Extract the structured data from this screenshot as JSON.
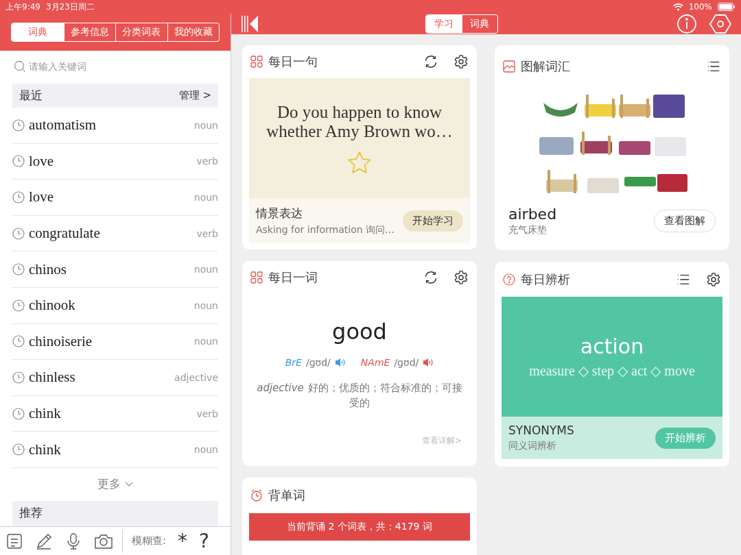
{
  "status_bar": {
    "time": "上午9:49",
    "date": "3月23日周二",
    "battery": "100%"
  },
  "sidebar": {
    "tabs": [
      {
        "label": "词典",
        "selected": true
      },
      {
        "label": "参考信息",
        "selected": false
      },
      {
        "label": "分类词表",
        "selected": false
      },
      {
        "label": "我的收藏",
        "selected": false
      }
    ],
    "search": {
      "placeholder": "请输入关键词"
    },
    "recent": {
      "title": "最近",
      "action": "管理 >"
    },
    "history": [
      {
        "word": "automatism",
        "pos": "noun"
      },
      {
        "word": "love",
        "pos": "verb"
      },
      {
        "word": "love",
        "pos": "noun"
      },
      {
        "word": "congratulate",
        "pos": "verb"
      },
      {
        "word": "chinos",
        "pos": "noun"
      },
      {
        "word": "chinook",
        "pos": "noun"
      },
      {
        "word": "chinoiserie",
        "pos": "noun"
      },
      {
        "word": "chinless",
        "pos": "adjective"
      },
      {
        "word": "chink",
        "pos": "verb"
      },
      {
        "word": "chink",
        "pos": "noun"
      }
    ],
    "more": "更多",
    "recommend": {
      "title": "推荐"
    },
    "toolbar": {
      "fuzzy_label": "模糊查:",
      "keys": [
        "*",
        "?"
      ]
    }
  },
  "mode_tabs": [
    {
      "label": "学习",
      "selected": true
    },
    {
      "label": "词典",
      "selected": false
    }
  ],
  "daily_sentence": {
    "title": "每日一句",
    "sentence_lines": [
      "Do you happen to know",
      "whether Amy Brown wo…"
    ],
    "category": "情景表达",
    "subtitle": "Asking for information 询问…",
    "button": "开始学习"
  },
  "illustrated": {
    "title": "图解词汇",
    "word": "airbed",
    "translation": "充气床垫",
    "button": "查看图解"
  },
  "daily_word": {
    "title": "每日一词",
    "word": "good",
    "pronunciations": [
      {
        "label": "BrE",
        "ipa": "/gʊd/",
        "color": "#3a9be0"
      },
      {
        "label": "NAmE",
        "ipa": "/gʊd/",
        "color": "#e85050"
      }
    ],
    "pos": "adjective",
    "definition": "好的；优质的；符合标准的；可接受的",
    "link": "查看详解>"
  },
  "daily_compare": {
    "title": "每日辨析",
    "headword": "action",
    "synonyms": "measure ◇ step ◇ act ◇ move",
    "label": "SYNONYMS",
    "subtitle": "同义词辨析",
    "button": "开始辨析"
  },
  "recite": {
    "title": "背单词",
    "banner": "当前背诵 2 个词表，共：4179 词"
  }
}
